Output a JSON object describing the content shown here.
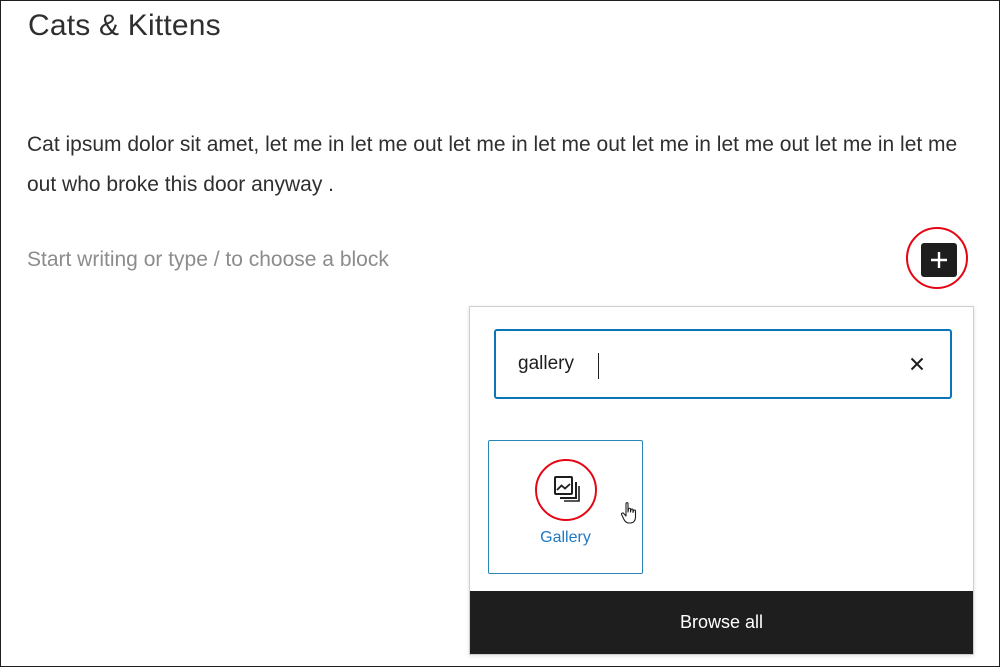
{
  "post": {
    "title": "Cats & Kittens",
    "paragraph": "Cat ipsum dolor sit amet, let me in let me out let me in let me out let me in let me out let me in let me out who broke this door anyway .",
    "placeholder": "Start writing or type / to choose a block"
  },
  "inserter": {
    "toggle_icon": "plus-icon",
    "search_value": "gallery",
    "clear_icon": "close-icon",
    "results": [
      {
        "label": "Gallery",
        "icon": "gallery-icon"
      }
    ],
    "browse_all_label": "Browse all"
  },
  "colors": {
    "accent": "#007cba",
    "highlight_ring": "#e30613",
    "dark": "#1e1e1e"
  }
}
